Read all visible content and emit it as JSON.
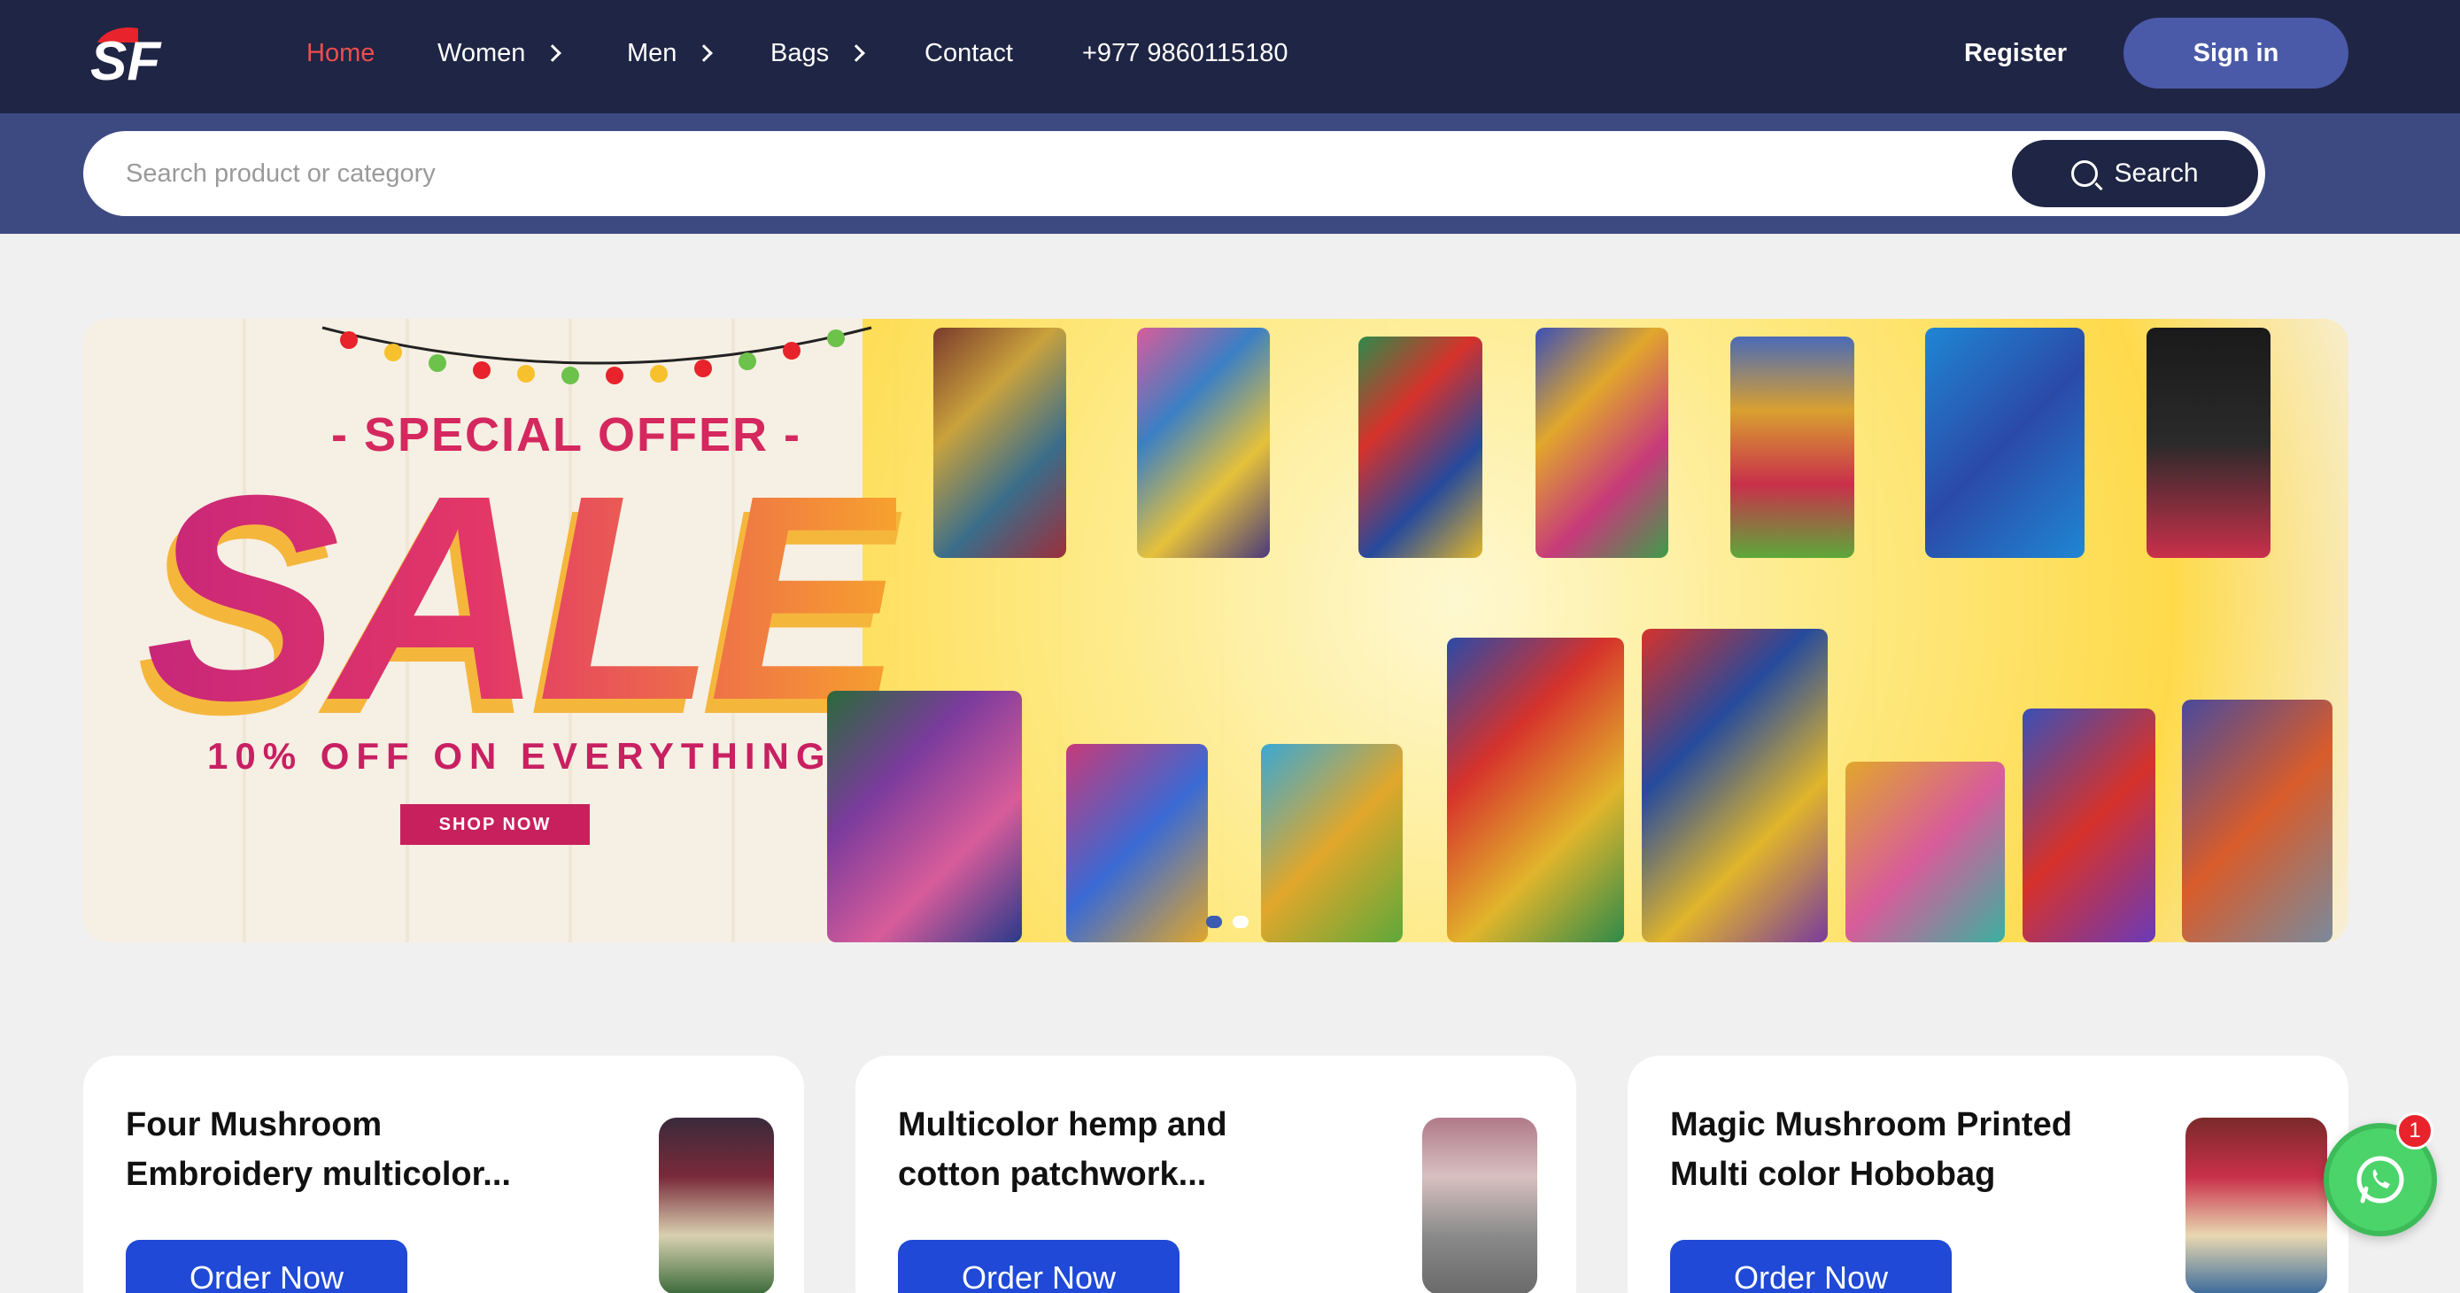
{
  "nav": {
    "items": [
      {
        "label": "Home",
        "active": true,
        "has_chevron": false
      },
      {
        "label": "Women",
        "active": false,
        "has_chevron": true
      },
      {
        "label": "Men",
        "active": false,
        "has_chevron": true
      },
      {
        "label": "Bags",
        "active": false,
        "has_chevron": true
      },
      {
        "label": "Contact",
        "active": false,
        "has_chevron": false
      }
    ],
    "phone": "+977 9860115180",
    "register": "Register",
    "signin": "Sign in"
  },
  "search": {
    "placeholder": "Search product or category",
    "button": "Search"
  },
  "banner": {
    "tag": "- SPECIAL OFFER -",
    "headline": "SALE",
    "subline": "10% OFF ON EVERYTHING",
    "cta": "SHOP NOW",
    "slides": 2,
    "active_slide": 1
  },
  "products": [
    {
      "title": "Four Mushroom Embroidery multicolor...",
      "cta": "Order Now"
    },
    {
      "title": "Multicolor hemp and cotton patchwork...",
      "cta": "Order Now"
    },
    {
      "title": "Magic Mushroom Printed Multi color Hobobag",
      "cta": "Order Now"
    }
  ],
  "whatsapp": {
    "badge": "1"
  },
  "colors": {
    "nav_bg": "#1f2544",
    "search_band": "#3d4a82",
    "active_link": "#ef4d4d",
    "signin_bg": "#4a5aa8",
    "order_btn": "#1f49d6",
    "sale_pink": "#d4285f",
    "whatsapp": "#4bd46a"
  }
}
